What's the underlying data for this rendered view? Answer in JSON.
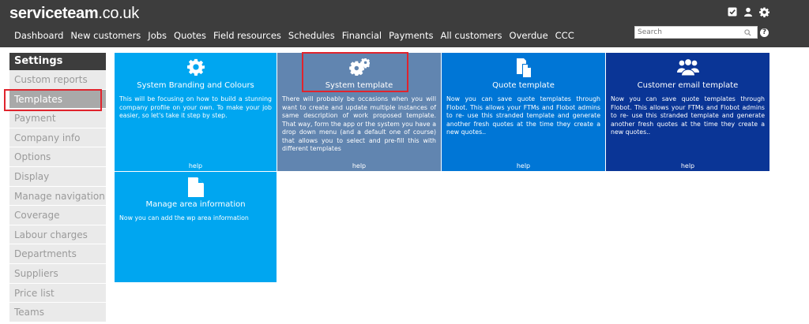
{
  "header": {
    "logo_main": "serviceteam",
    "logo_domain": ".co.uk",
    "nav": [
      "Dashboard",
      "New customers",
      "Jobs",
      "Quotes",
      "Field resources",
      "Schedules",
      "Financial",
      "Payments",
      "All customers",
      "Overdue",
      "CCC"
    ],
    "search_placeholder": "Search",
    "help_label": "?",
    "icons": [
      "checkbox-icon",
      "user-icon",
      "gear-icon",
      "search-icon",
      "help-icon"
    ]
  },
  "sidebar": {
    "title": "Settings",
    "items": [
      "Custom reports",
      "Templates",
      "Payment",
      "Company info",
      "Options",
      "Display",
      "Manage navigation",
      "Coverage",
      "Labour charges",
      "Departments",
      "Suppliers",
      "Price list",
      "Teams"
    ],
    "active_item": "Templates"
  },
  "tiles": [
    {
      "title": "System Branding and Colours",
      "desc": "This will be focusing on how to build a stunning company profile on your own. To make your job easier, so let's take it step by step.",
      "help": "help",
      "icon": "gear-icon",
      "color": "#00a6f0"
    },
    {
      "title": "System template",
      "desc": "There will probably be occasions when you will want to create and update multiple instances of same description of work proposed template. That way, form the app or the system you have a drop down menu (and a default one of course) that allows you to select and pre-fill this with different templates",
      "help": "help",
      "icon": "gears-icon",
      "color": "#6185b0"
    },
    {
      "title": "Quote template",
      "desc": "Now you can save quote templates through Flobot. This allows your FTMs and Flobot admins to re- use this stranded template and generate another fresh quotes at the time they create a new quotes..",
      "help": "help",
      "icon": "document-copy-icon",
      "color": "#0076d6"
    },
    {
      "title": "Customer email template",
      "desc": "Now you can save quote templates through Flobot. This allows your FTMs and Flobot admins to re- use this stranded template and generate another fresh quotes at the time they create a new quotes..",
      "help": "help",
      "icon": "users-icon",
      "color": "#0a3596"
    },
    {
      "title": "Manage area information",
      "desc": "Now you can add the wp area information",
      "help": "",
      "icon": "file-icon",
      "color": "#00a6f0"
    }
  ],
  "colors": {
    "topbar": "#3d3d3d",
    "highlight": "#e0242d",
    "sidebar_bg": "#eaeaea",
    "sidebar_active": "#a9a9a9"
  }
}
